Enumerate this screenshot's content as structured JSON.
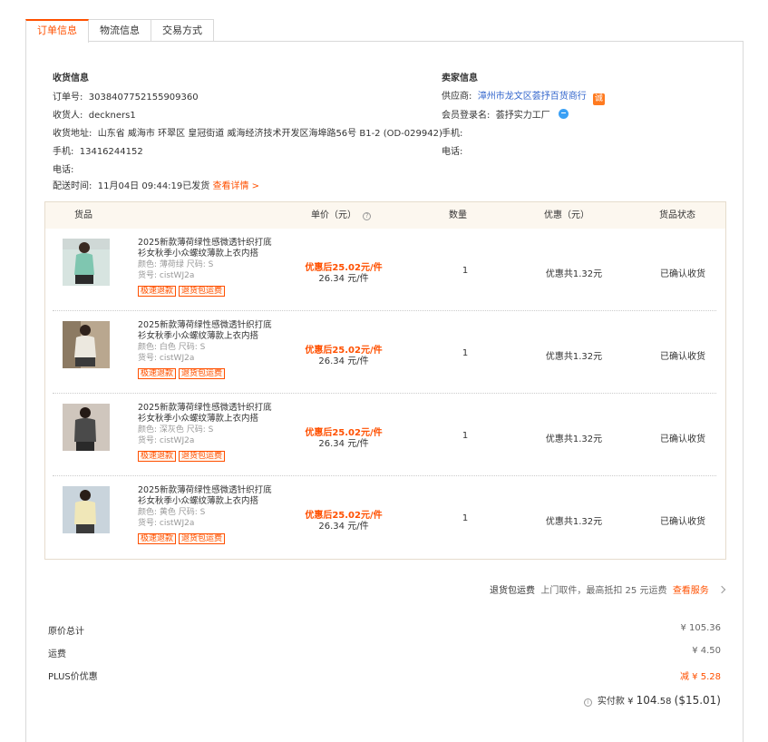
{
  "tabs": [
    "订单信息",
    "物流信息",
    "交易方式"
  ],
  "buyer": {
    "title": "收货信息",
    "order_label": "订单号:",
    "order_no": "3038407752155909360",
    "receiver_label": "收货人:",
    "receiver": "deckners1",
    "address_label": "收货地址:",
    "address": "山东省 威海市 环翠区 皇冠街道 威海经济技术开发区海埠路56号 B1-2 (OD-029942)",
    "phone_label": "手机:",
    "phone": "13416244152",
    "tel_label": "电话:",
    "delivery_label": "配送时间:",
    "delivery": "11月04日 09:44:19已发货",
    "detail_link": "查看详情 >"
  },
  "seller": {
    "title": "卖家信息",
    "supplier_label": "供应商:",
    "supplier": "漳州市龙文区荟抒百货商行",
    "cheng": "诚",
    "member_label": "会员登录名:",
    "member": "荟抒实力工厂",
    "phone_label": "手机:",
    "tel_label": "电话:"
  },
  "table": {
    "headers": {
      "goods": "货品",
      "price": "单价（元）",
      "qty": "数量",
      "discount": "优惠（元）",
      "status": "货品状态"
    },
    "help_glyph": "?",
    "rows": [
      {
        "name": "2025新款薄荷绿性感微透针织打底衫女秋季小众螺纹薄款上衣内搭",
        "color": "颜色: 薄荷绿 尺码: S",
        "sku": "货号: cistWJ2a",
        "tag1": "极速退款",
        "tag2": "退货包运费",
        "promo": "优惠后25.02元/件",
        "unit": "26.34 元/件",
        "qty": "1",
        "discount": "优惠共1.32元",
        "status": "已确认收货",
        "swatch": "#7fc6b0"
      },
      {
        "name": "2025新款薄荷绿性感微透针织打底衫女秋季小众螺纹薄款上衣内搭",
        "color": "颜色: 白色 尺码: S",
        "sku": "货号: cistWJ2a",
        "tag1": "极速退款",
        "tag2": "退货包运费",
        "promo": "优惠后25.02元/件",
        "unit": "26.34 元/件",
        "qty": "1",
        "discount": "优惠共1.32元",
        "status": "已确认收货",
        "swatch": "#ece8df"
      },
      {
        "name": "2025新款薄荷绿性感微透针织打底衫女秋季小众螺纹薄款上衣内搭",
        "color": "颜色: 深灰色 尺码: S",
        "sku": "货号: cistWJ2a",
        "tag1": "极速退款",
        "tag2": "退货包运费",
        "promo": "优惠后25.02元/件",
        "unit": "26.34 元/件",
        "qty": "1",
        "discount": "优惠共1.32元",
        "status": "已确认收货",
        "swatch": "#4a4a4a"
      },
      {
        "name": "2025新款薄荷绿性感微透针织打底衫女秋季小众螺纹薄款上衣内搭",
        "color": "颜色: 黄色 尺码: S",
        "sku": "货号: cistWJ2a",
        "tag1": "极速退款",
        "tag2": "退货包运费",
        "promo": "优惠后25.02元/件",
        "unit": "26.34 元/件",
        "qty": "1",
        "discount": "优惠共1.32元",
        "status": "已确认收货",
        "swatch": "#f0e7b8"
      }
    ]
  },
  "return_service": {
    "title": "退货包运费",
    "desc": "上门取件，最高抵扣 25 元运费",
    "link": "查看服务"
  },
  "summary": {
    "original_label": "原价总计",
    "original": "¥ 105.36",
    "shipping_label": "运费",
    "shipping": "¥ 4.50",
    "plus_label": "PLUS价优惠",
    "plus": "减 ¥ 5.28",
    "info_glyph": "i",
    "paid_label": "实付款",
    "paid_currency": "¥",
    "paid_main": "104",
    "paid_dec": ".58",
    "paid_usd": "($15.01)"
  }
}
